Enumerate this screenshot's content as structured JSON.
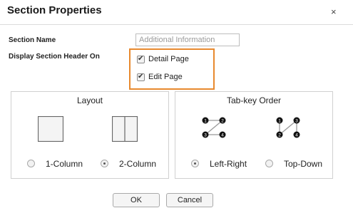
{
  "dialog": {
    "title": "Section Properties",
    "close_symbol": "×"
  },
  "form": {
    "section_name_label": "Section Name",
    "section_name_placeholder": "Additional Information",
    "section_name_value": "",
    "display_header_label": "Display Section Header On",
    "options": [
      {
        "label": "Detail Page",
        "checked": true
      },
      {
        "label": "Edit Page",
        "checked": true
      }
    ],
    "highlight_color": "#e8892e"
  },
  "layout_panel": {
    "title": "Layout",
    "options": [
      {
        "label": "1-Column",
        "selected": false,
        "icon": "one-column-icon"
      },
      {
        "label": "2-Column",
        "selected": true,
        "icon": "two-column-icon"
      }
    ]
  },
  "tab_order_panel": {
    "title": "Tab-key Order",
    "options": [
      {
        "label": "Left-Right",
        "selected": true,
        "icon": "left-right-order-icon"
      },
      {
        "label": "Top-Down",
        "selected": false,
        "icon": "top-down-order-icon"
      }
    ],
    "node_labels": [
      "1",
      "2",
      "3",
      "4"
    ]
  },
  "buttons": {
    "ok": "OK",
    "cancel": "Cancel"
  }
}
